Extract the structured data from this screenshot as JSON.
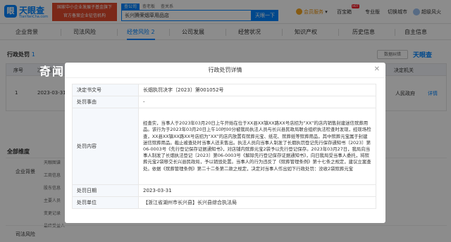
{
  "header": {
    "logo_text": "天眼查",
    "logo_sub": "TianYanCha.com",
    "slogan_line1": "国家中小企业发展子基金旗下",
    "slogan_line2": "官方备案企业征信机构",
    "search_tabs": [
      "查公司",
      "查老板",
      "查关系"
    ],
    "search_value": "长兴腾荣烟草用品店",
    "search_button": "天眼一下",
    "vip_label": "会员服务",
    "nav": [
      "百宝箱",
      "专业版",
      "切换城市",
      "超级风火"
    ],
    "hot_badge": "HOT"
  },
  "modules": [
    {
      "label": "企业背景"
    },
    {
      "label": "司法风险"
    },
    {
      "label": "经营风险",
      "count": "2"
    },
    {
      "label": "公司发展"
    },
    {
      "label": "经营状况"
    },
    {
      "label": "知识产权"
    },
    {
      "label": "历史信息"
    },
    {
      "label": "自主信息"
    }
  ],
  "section": {
    "title": "行政处罚",
    "count": "1",
    "download_label": "数据纠错",
    "right_logo": "天眼查",
    "watermark": "奇闻",
    "columns": [
      "序号",
      "决定日期",
      "决定机关"
    ],
    "row": {
      "index": "1",
      "date": "2023-03-31",
      "authority": "人民政府",
      "action": "详情"
    }
  },
  "side": {
    "title": "全部维度",
    "items": [
      "企业背景",
      "司法风险"
    ],
    "cells": [
      "天眼图谱",
      "工商信息",
      "股东信息",
      "主要人员",
      "变更记录",
      "最终受益人"
    ]
  },
  "modal": {
    "title": "行政处罚详情",
    "close_icon": "close-icon",
    "rows": [
      {
        "key": "决定书文号",
        "value": "长烟执罚决字〔2023〕第001052号"
      },
      {
        "key": "处罚事由",
        "value": "-"
      },
      {
        "key": "处罚内容",
        "value": "经查实，当事人于2023年03月20日上午开始在位于XX县XX镇XX路XX号店招为“XX”的店内销售封建迷信殡葬用品。该行为于2023年03月20日上午10时00分被我局执法人员与长兴县民政局联合组织执法检查时发现，经现场检查，XX县XX镇XX路XX号店招为“XX”的店内放置有殡葬元宝、纸花、殡葬纸等殡葬用品，其中殡葬元宝属于封建迷信殡葬用品。截止被查处时当事人还未售出。执法人员向当事人制发了长烟执罚登记先行保存通知书〔2023〕第06-0003号《先行登记保存证据通知书》，对店铺内殡葬元宝2袋予以先行登记保存。2023年03月27日，我局向当事人制发了长烟执法登记〔2023〕第06-0003号《解除先行登记保存证据通知书》，向日我局受当事人委托，将殡葬元宝2袋移交长兴县民政局，予以销毁处置。当事人的行为违反了《殡葬管理条例》第十七条之规定，建议立案查处。依据《殡葬管理条例》第二十二条第二款之规定，决定对当事人作出如下行政处罚：没收2袋殡葬元宝"
      },
      {
        "key": "处罚日期",
        "value": "2023-03-31"
      },
      {
        "key": "处罚单位",
        "value": "【浙江省湖州市长兴县】长兴县综合执法局"
      }
    ]
  }
}
